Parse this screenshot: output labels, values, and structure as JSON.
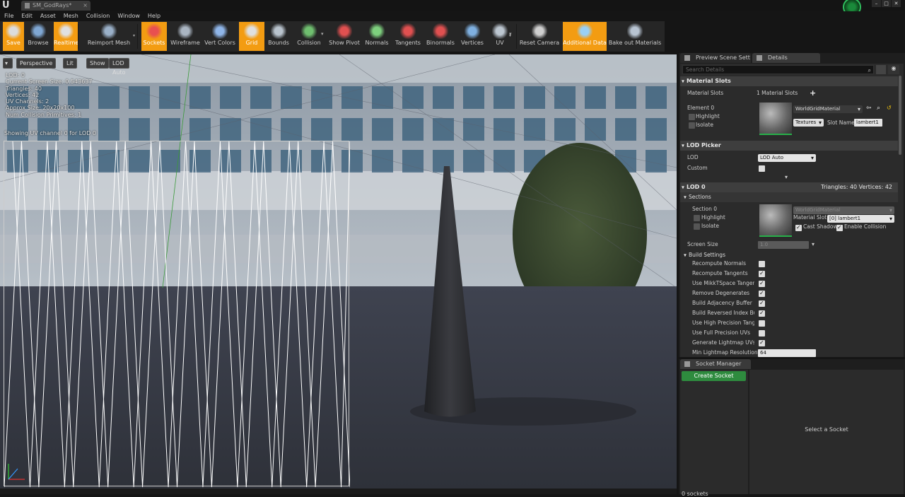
{
  "title_bar": {
    "tab_label": "SM_GodRays*"
  },
  "menu": [
    "File",
    "Edit",
    "Asset",
    "Mesh",
    "Collision",
    "Window",
    "Help"
  ],
  "toolbar": [
    {
      "label": "Save",
      "icon": "save-icon",
      "active": true
    },
    {
      "label": "Browse",
      "icon": "browse-icon",
      "active": false
    },
    {
      "label": "Realtime",
      "icon": "realtime-icon",
      "active": true
    },
    {
      "label": "Reimport Mesh",
      "icon": "reimport-icon",
      "active": false
    },
    {
      "label": "Sockets",
      "icon": "sockets-icon",
      "active": true
    },
    {
      "label": "Wireframe",
      "icon": "wireframe-icon",
      "active": false
    },
    {
      "label": "Vert Colors",
      "icon": "vert-colors-icon",
      "active": false
    },
    {
      "label": "Grid",
      "icon": "grid-icon",
      "active": true
    },
    {
      "label": "Bounds",
      "icon": "bounds-icon",
      "active": false
    },
    {
      "label": "Collision",
      "icon": "collision-icon",
      "active": false
    },
    {
      "label": "Show Pivot",
      "icon": "pivot-icon",
      "active": false
    },
    {
      "label": "Normals",
      "icon": "normals-icon",
      "active": false
    },
    {
      "label": "Tangents",
      "icon": "tangents-icon",
      "active": false
    },
    {
      "label": "Binormals",
      "icon": "binormals-icon",
      "active": false
    },
    {
      "label": "Vertices",
      "icon": "vertices-icon",
      "active": false
    },
    {
      "label": "UV",
      "icon": "uv-icon",
      "active": false
    },
    {
      "label": "Reset Camera",
      "icon": "camera-icon",
      "active": false
    },
    {
      "label": "Additional Data",
      "icon": "additional-data-icon",
      "active": true
    },
    {
      "label": "Bake out Materials",
      "icon": "bake-icon",
      "active": false
    }
  ],
  "viewport": {
    "buttons": {
      "perspective": "Perspective",
      "lit": "Lit",
      "show": "Show",
      "lod": "LOD Auto"
    },
    "stats": [
      "LOD:  0",
      "Current Screen Size:  0.543637",
      "Triangles:  40",
      "Vertices:  42",
      "UV Channels:  2",
      "Approx Size: 20x20x100",
      "Num Collision Primitives:  1"
    ],
    "uv_message": "Showing UV channel 0 for LOD 0"
  },
  "panel_tabs": {
    "preview": "Preview Scene Sett",
    "details": "Details"
  },
  "details": {
    "search_placeholder": "Search Details",
    "material_slots": {
      "header": "Material Slots",
      "label": "Material Slots",
      "count": "1 Material Slots",
      "element": "Element 0",
      "highlight": "Highlight",
      "isolate": "Isolate",
      "material": "WorldGridMaterial",
      "textures": "Textures",
      "slot_name_label": "Slot Name",
      "slot_name": "lambert1"
    },
    "lod_picker": {
      "header": "LOD Picker",
      "lod_label": "LOD",
      "lod_value": "LOD Auto",
      "custom_label": "Custom"
    },
    "lod0": {
      "header": "LOD 0",
      "stats": "Triangles: 40   Vertices: 42",
      "sections": "Sections",
      "section0": "Section 0",
      "highlight": "Highlight",
      "isolate": "Isolate",
      "material": "WorldGridMaterial",
      "material_slot_label": "Material Slot",
      "material_slot": "[0] lambert1",
      "cast_shadow": "Cast Shadow",
      "enable_collision": "Enable Collision",
      "screen_size_label": "Screen Size",
      "screen_size": "1.0"
    },
    "build_settings": {
      "header": "Build Settings",
      "items": [
        {
          "label": "Recompute Normals",
          "checked": false
        },
        {
          "label": "Recompute Tangents",
          "checked": true
        },
        {
          "label": "Use MikkTSpace Tangent",
          "checked": true
        },
        {
          "label": "Remove Degenerates",
          "checked": true
        },
        {
          "label": "Build Adjacency Buffer",
          "checked": true
        },
        {
          "label": "Build Reversed Index Buffe",
          "checked": true
        },
        {
          "label": "Use High Precision Tanger",
          "checked": false
        },
        {
          "label": "Use Full Precision UVs",
          "checked": false
        },
        {
          "label": "Generate Lightmap UVs",
          "checked": true
        }
      ],
      "min_lightmap_label": "Min Lightmap Resolution",
      "min_lightmap": "64"
    }
  },
  "socket_manager": {
    "tab": "Socket Manager",
    "create": "Create Socket",
    "count": "0 sockets",
    "empty": "Select a Socket"
  },
  "colors": {
    "accent": "#f39c12",
    "green": "#2e8b3e",
    "panel": "#2b2b2b"
  }
}
